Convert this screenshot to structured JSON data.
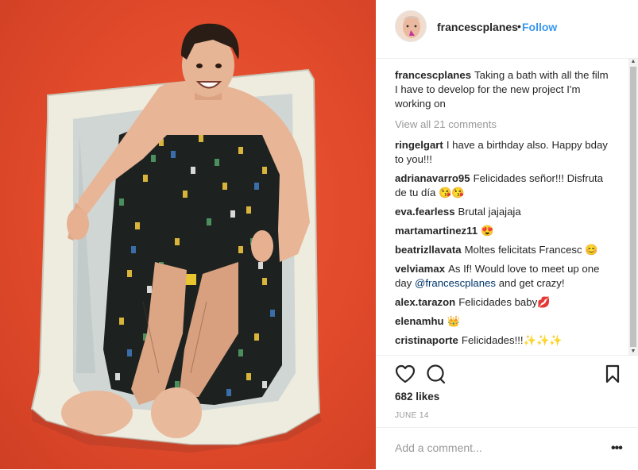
{
  "post": {
    "username": "francescplanes",
    "separator": "•",
    "follow_label": "Follow",
    "caption": "Taking a bath with all the film I have to develop for the new project I'm working on",
    "view_all": "View all 21 comments",
    "likes": "682 likes",
    "date": "JUNE 14",
    "add_comment_placeholder": "Add a comment...",
    "more_label": "•••"
  },
  "comments": [
    {
      "user": "ringelgart",
      "text": "I have a birthday also. Happy bday to you!!!"
    },
    {
      "user": "adrianavarro95",
      "text": "Felicidades señor!!! Disfruta de tu día 😘😘"
    },
    {
      "user": "eva.fearless",
      "text": "Brutal jajajaja"
    },
    {
      "user": "martamartinez11",
      "text": "😍"
    },
    {
      "user": "beatrizllavata",
      "text": "Moltes felicitats Francesc 😊"
    },
    {
      "user": "velviamax",
      "text_before": "As If! Would love to meet up one day ",
      "mention": "@francescplanes",
      "text_after": " and get crazy!"
    },
    {
      "user": "alex.tarazon",
      "text": "Felicidades baby💋"
    },
    {
      "user": "elenamhu",
      "text": "👑"
    },
    {
      "user": "cristinaporte",
      "text": "Felicidades!!!✨✨✨"
    }
  ],
  "icons": {
    "like": "heart-icon",
    "comment": "comment-bubble-icon",
    "save": "bookmark-icon",
    "more": "more-options-icon"
  },
  "colors": {
    "accent": "#3897f0",
    "photo_background": "#e14a2b",
    "muted_text": "#999999"
  }
}
